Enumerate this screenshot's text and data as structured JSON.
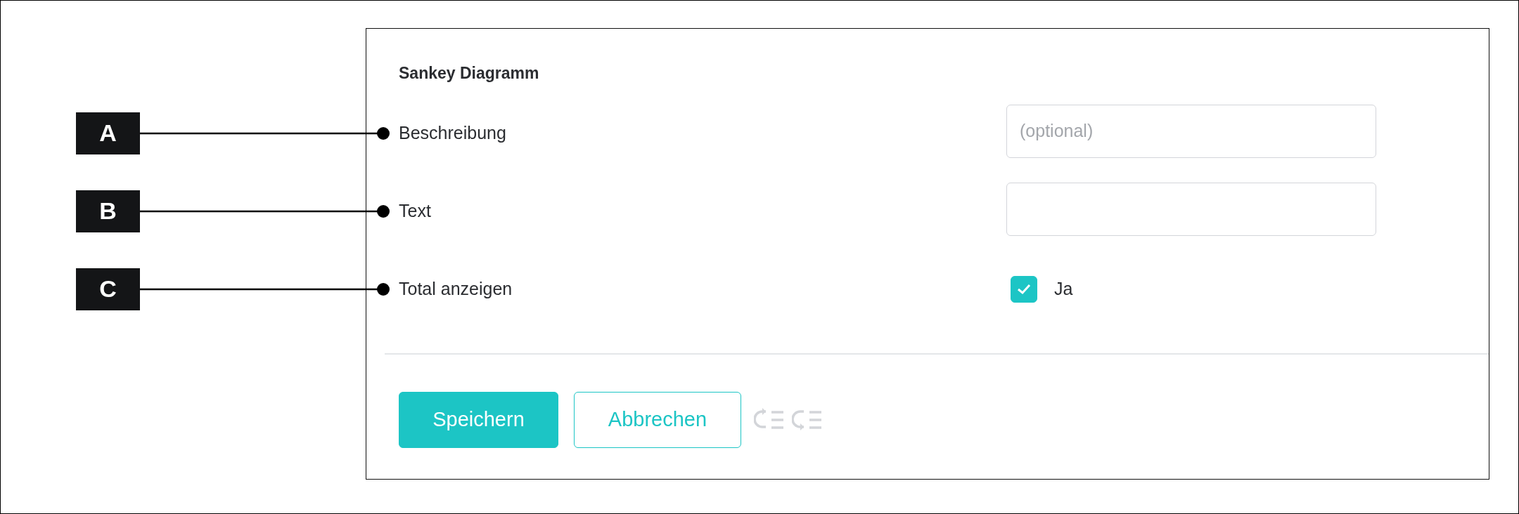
{
  "panel": {
    "title": "Sankey Diagramm",
    "fields": [
      {
        "kind": "text",
        "callout": "A",
        "label": "Beschreibung",
        "placeholder": "(optional)"
      },
      {
        "kind": "text",
        "callout": "B",
        "label": "Text"
      },
      {
        "kind": "checkbox",
        "callout": "C",
        "label": "Total anzeigen",
        "checked": true,
        "option": "Ja"
      }
    ],
    "buttons": [
      {
        "kind": "primary",
        "label": "Speichern"
      },
      {
        "kind": "secondary",
        "label": "Abbrechen"
      }
    ],
    "toolbar_icons": [
      {
        "kind": "undo",
        "disabled": true
      },
      {
        "kind": "redo",
        "disabled": true
      }
    ]
  }
}
